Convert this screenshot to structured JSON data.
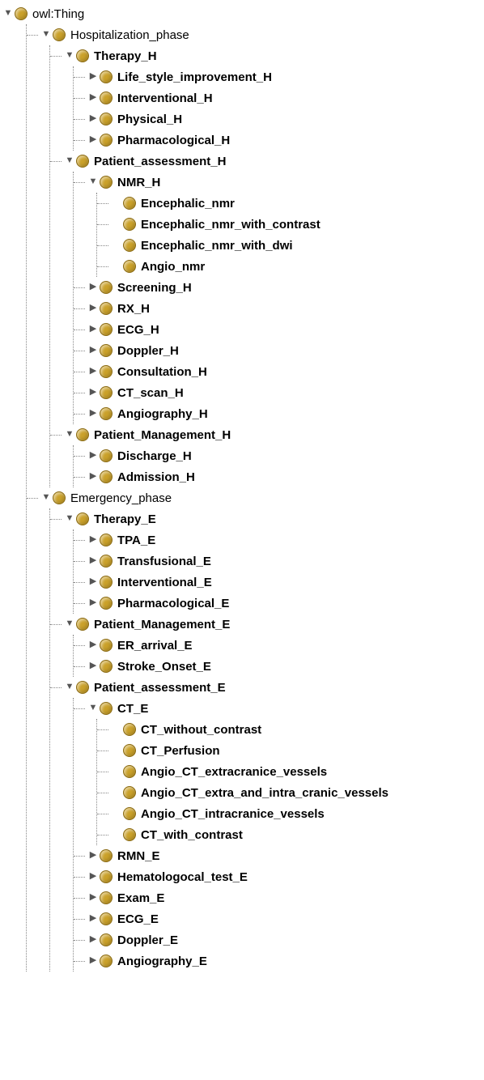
{
  "tree": {
    "label": "owl:Thing",
    "bold": false,
    "toggle": "open",
    "children": [
      {
        "label": "Hospitalization_phase",
        "bold": false,
        "toggle": "open",
        "children": [
          {
            "label": "Therapy_H",
            "bold": true,
            "toggle": "open",
            "children": [
              {
                "label": "Life_style_improvement_H",
                "bold": true,
                "toggle": "closed"
              },
              {
                "label": "Interventional_H",
                "bold": true,
                "toggle": "closed"
              },
              {
                "label": "Physical_H",
                "bold": true,
                "toggle": "closed"
              },
              {
                "label": "Pharmacological_H",
                "bold": true,
                "toggle": "closed"
              }
            ]
          },
          {
            "label": "Patient_assessment_H",
            "bold": true,
            "toggle": "open",
            "children": [
              {
                "label": "NMR_H",
                "bold": true,
                "toggle": "open",
                "children": [
                  {
                    "label": "Encephalic_nmr",
                    "bold": true,
                    "toggle": "leaf"
                  },
                  {
                    "label": "Encephalic_nmr_with_contrast",
                    "bold": true,
                    "toggle": "leaf"
                  },
                  {
                    "label": "Encephalic_nmr_with_dwi",
                    "bold": true,
                    "toggle": "leaf"
                  },
                  {
                    "label": "Angio_nmr",
                    "bold": true,
                    "toggle": "leaf"
                  }
                ]
              },
              {
                "label": "Screening_H",
                "bold": true,
                "toggle": "closed"
              },
              {
                "label": "RX_H",
                "bold": true,
                "toggle": "closed"
              },
              {
                "label": "ECG_H",
                "bold": true,
                "toggle": "closed"
              },
              {
                "label": "Doppler_H",
                "bold": true,
                "toggle": "closed"
              },
              {
                "label": "Consultation_H",
                "bold": true,
                "toggle": "closed"
              },
              {
                "label": "CT_scan_H",
                "bold": true,
                "toggle": "closed"
              },
              {
                "label": "Angiography_H",
                "bold": true,
                "toggle": "closed"
              }
            ]
          },
          {
            "label": "Patient_Management_H",
            "bold": true,
            "toggle": "open",
            "children": [
              {
                "label": "Discharge_H",
                "bold": true,
                "toggle": "closed"
              },
              {
                "label": "Admission_H",
                "bold": true,
                "toggle": "closed"
              }
            ]
          }
        ]
      },
      {
        "label": "Emergency_phase",
        "bold": false,
        "toggle": "open",
        "children": [
          {
            "label": "Therapy_E",
            "bold": true,
            "toggle": "open",
            "children": [
              {
                "label": "TPA_E",
                "bold": true,
                "toggle": "closed"
              },
              {
                "label": "Transfusional_E",
                "bold": true,
                "toggle": "closed"
              },
              {
                "label": "Interventional_E",
                "bold": true,
                "toggle": "closed"
              },
              {
                "label": "Pharmacological_E",
                "bold": true,
                "toggle": "closed"
              }
            ]
          },
          {
            "label": "Patient_Management_E",
            "bold": true,
            "toggle": "open",
            "children": [
              {
                "label": "ER_arrival_E",
                "bold": true,
                "toggle": "closed"
              },
              {
                "label": "Stroke_Onset_E",
                "bold": true,
                "toggle": "closed"
              }
            ]
          },
          {
            "label": "Patient_assessment_E",
            "bold": true,
            "toggle": "open",
            "children": [
              {
                "label": "CT_E",
                "bold": true,
                "toggle": "open",
                "children": [
                  {
                    "label": "CT_without_contrast",
                    "bold": true,
                    "toggle": "leaf"
                  },
                  {
                    "label": "CT_Perfusion",
                    "bold": true,
                    "toggle": "leaf"
                  },
                  {
                    "label": "Angio_CT_extracranice_vessels",
                    "bold": true,
                    "toggle": "leaf"
                  },
                  {
                    "label": "Angio_CT_extra_and_intra_cranic_vessels",
                    "bold": true,
                    "toggle": "leaf"
                  },
                  {
                    "label": "Angio_CT_intracranice_vessels",
                    "bold": true,
                    "toggle": "leaf"
                  },
                  {
                    "label": "CT_with_contrast",
                    "bold": true,
                    "toggle": "leaf"
                  }
                ]
              },
              {
                "label": "RMN_E",
                "bold": true,
                "toggle": "closed"
              },
              {
                "label": "Hematologocal_test_E",
                "bold": true,
                "toggle": "closed"
              },
              {
                "label": "Exam_E",
                "bold": true,
                "toggle": "closed"
              },
              {
                "label": "ECG_E",
                "bold": true,
                "toggle": "closed"
              },
              {
                "label": "Doppler_E",
                "bold": true,
                "toggle": "closed"
              },
              {
                "label": "Angiography_E",
                "bold": true,
                "toggle": "closed"
              }
            ]
          }
        ]
      }
    ]
  },
  "glyphs": {
    "open": "▼",
    "closed": "▶",
    "leaf": ""
  }
}
